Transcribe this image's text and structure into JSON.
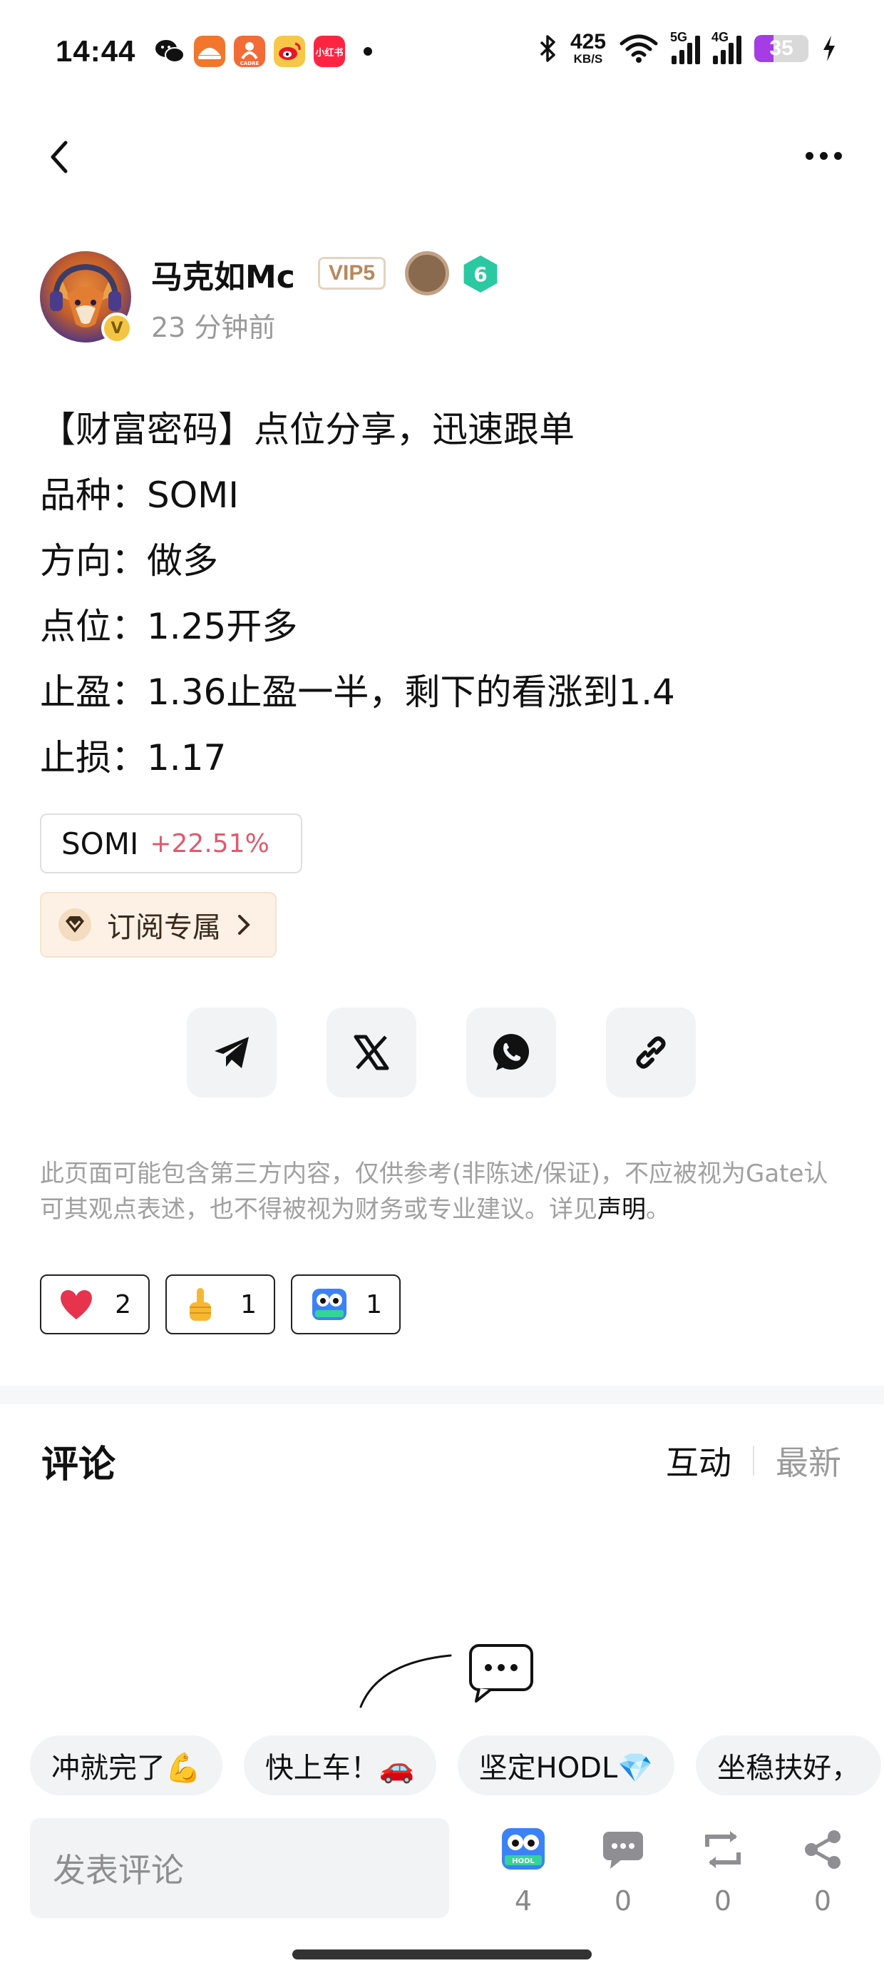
{
  "status_bar": {
    "time": "14:44",
    "net_speed": "425",
    "net_unit": "KB/S",
    "signal_5g": "5G",
    "signal_4g": "4G",
    "battery": "35",
    "battery_level": 0.35,
    "app_icons": [
      "wechat-icon",
      "food-app-icon",
      "cadre-app-icon",
      "weibo-icon",
      "xiaohongshu-icon"
    ],
    "xhs_label": "小红书",
    "cadre_label": "CADRE"
  },
  "author": {
    "name": "马克如Mc",
    "vip": "VIP5",
    "level": "6",
    "badge": "V",
    "time_ago": "23 分钟前"
  },
  "post": {
    "lines": [
      "【财富密码】点位分享，迅速跟单",
      "品种：SOMI",
      "方向：做多",
      "点位：1.25开多",
      "止盈：1.36止盈一半，剩下的看涨到1.4",
      "止损：1.17"
    ]
  },
  "ticker": {
    "symbol": "SOMI",
    "change": "+22.51%",
    "change_color": "#e05a6e"
  },
  "subscribe": {
    "label": "订阅专属"
  },
  "share": [
    "telegram-icon",
    "x-icon",
    "whatsapp-icon",
    "link-icon"
  ],
  "disclaimer": {
    "text": "此页面可能包含第三方内容，仅供参考(非陈述/保证)，不应被视为Gate认可其观点表述，也不得被视为财务或专业建议。详见",
    "link": "声明",
    "end": "。"
  },
  "reactions": [
    {
      "icon": "heart-icon",
      "count": "2"
    },
    {
      "icon": "thumbs-up-icon",
      "count": "1"
    },
    {
      "icon": "hodl-icon",
      "count": "1"
    }
  ],
  "comments": {
    "title": "评论",
    "tabs": [
      "互动",
      "最新"
    ],
    "active_tab": "互动"
  },
  "quick_replies": [
    "冲就完了💪",
    "快上车！🚗",
    "坚定HODL💎",
    "坐稳扶好，"
  ],
  "bottom_bar": {
    "input_placeholder": "发表评论",
    "hodl_label": "HODL",
    "actions": [
      {
        "icon": "hodl-icon",
        "count": "4"
      },
      {
        "icon": "comment-icon",
        "count": "0"
      },
      {
        "icon": "repost-icon",
        "count": "0"
      },
      {
        "icon": "share-icon",
        "count": "0"
      }
    ]
  },
  "colors": {
    "accent_red": "#e05a6e",
    "vip_gold": "#b9885a",
    "level_teal": "#2bc9a1",
    "battery_purple": "#a53ce6"
  }
}
